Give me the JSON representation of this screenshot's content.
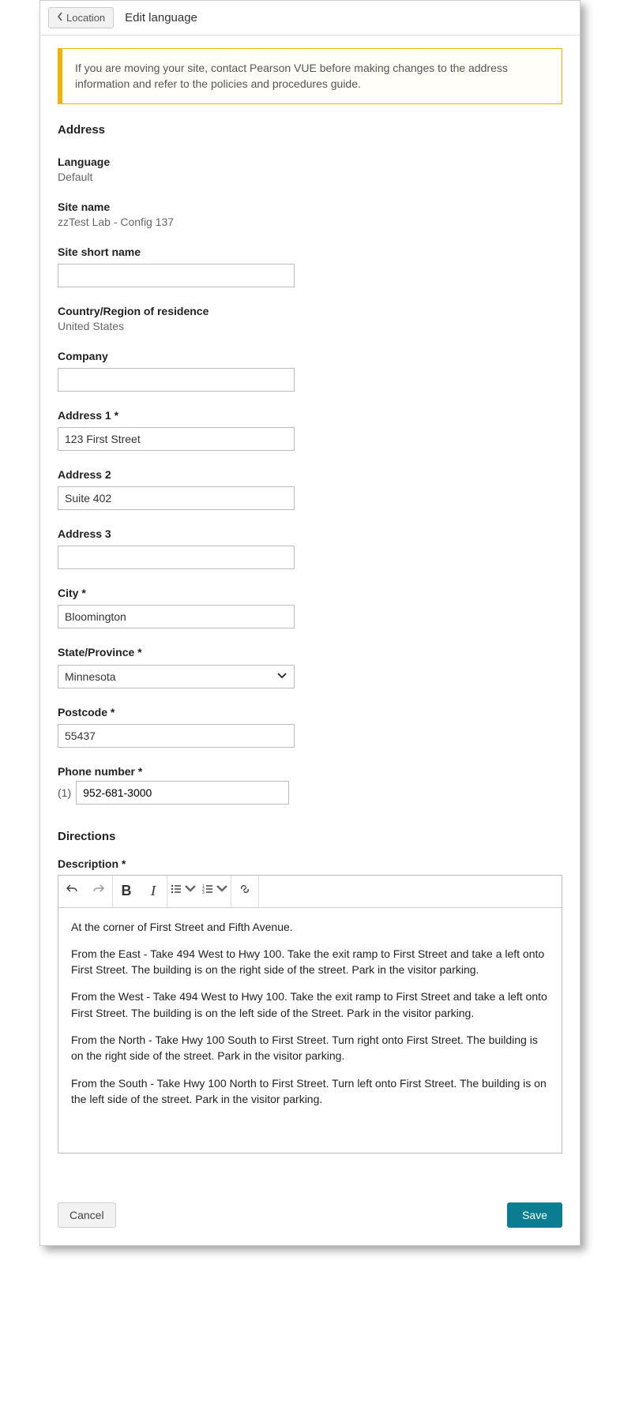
{
  "header": {
    "back_label": "Location",
    "title": "Edit language"
  },
  "alert": "If you are moving your site, contact Pearson VUE before making changes to the address information and refer to the policies and procedures guide.",
  "sections": {
    "address_heading": "Address",
    "directions_heading": "Directions"
  },
  "fields": {
    "language": {
      "label": "Language",
      "value": "Default"
    },
    "site_name": {
      "label": "Site name",
      "value": "zzTest Lab - Config 137"
    },
    "site_short_name": {
      "label": "Site short name",
      "value": ""
    },
    "country": {
      "label": "Country/Region of residence",
      "value": "United States"
    },
    "company": {
      "label": "Company",
      "value": ""
    },
    "address1": {
      "label": "Address 1 *",
      "value": "123 First Street"
    },
    "address2": {
      "label": "Address 2",
      "value": "Suite 402"
    },
    "address3": {
      "label": "Address 3",
      "value": ""
    },
    "city": {
      "label": "City *",
      "value": "Bloomington"
    },
    "state": {
      "label": "State/Province *",
      "value": "Minnesota"
    },
    "postcode": {
      "label": "Postcode *",
      "value": "55437"
    },
    "phone": {
      "label": "Phone number *",
      "prefix": "(1)",
      "value": "952-681-3000"
    },
    "description": {
      "label": "Description *"
    }
  },
  "description_paragraphs": [
    "At the corner of First Street and Fifth Avenue.",
    "From the East - Take 494 West to Hwy 100. Take the exit ramp to First Street and take a left onto First Street. The building is on the right side of the street. Park in the visitor parking.",
    "From the West - Take 494 West to Hwy 100. Take the exit ramp to First Street and take a left onto First Street. The building is on the left side of the Street. Park in the visitor parking.",
    "From the North - Take Hwy 100 South to First Street. Turn right onto First Street.  The building is on the right side of the street. Park in the visitor parking.",
    "From the South - Take Hwy 100 North to First Street. Turn left onto First Street. The building is on the left side of the street. Park in the visitor parking."
  ],
  "buttons": {
    "cancel": "Cancel",
    "save": "Save"
  }
}
